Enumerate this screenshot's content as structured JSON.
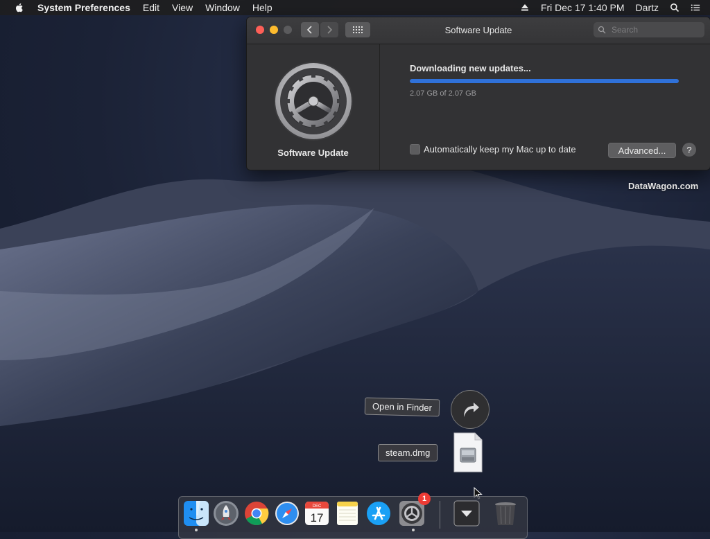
{
  "menubar": {
    "app_name": "System Preferences",
    "menus": [
      "Edit",
      "View",
      "Window",
      "Help"
    ],
    "clock": "Fri Dec 17  1:40 PM",
    "user": "Dartz"
  },
  "window": {
    "title": "Software Update",
    "search_placeholder": "Search",
    "sidebar_label": "Software Update",
    "status_text": "Downloading new updates...",
    "progress_fraction": 1.0,
    "size_text": "2.07 GB of 2.07 GB",
    "auto_update_label": "Automatically keep my Mac up to date",
    "auto_update_checked": false,
    "advanced_label": "Advanced...",
    "help_label": "?"
  },
  "watermark": "DataWagon.com",
  "stack_popup": {
    "open_label": "Open in Finder",
    "file_label": "steam.dmg"
  },
  "dock": {
    "items": [
      {
        "name": "finder-icon"
      },
      {
        "name": "launchpad-icon"
      },
      {
        "name": "chrome-icon"
      },
      {
        "name": "safari-icon"
      },
      {
        "name": "calendar-icon",
        "month": "DEC",
        "day": "17"
      },
      {
        "name": "notes-icon"
      },
      {
        "name": "app-store-icon"
      },
      {
        "name": "system-preferences-icon",
        "badge": "1"
      },
      {
        "name": "downloads-stack-icon"
      },
      {
        "name": "trash-icon"
      }
    ]
  },
  "colors": {
    "accent": "#2f71d9",
    "badge": "#ee3b35"
  }
}
